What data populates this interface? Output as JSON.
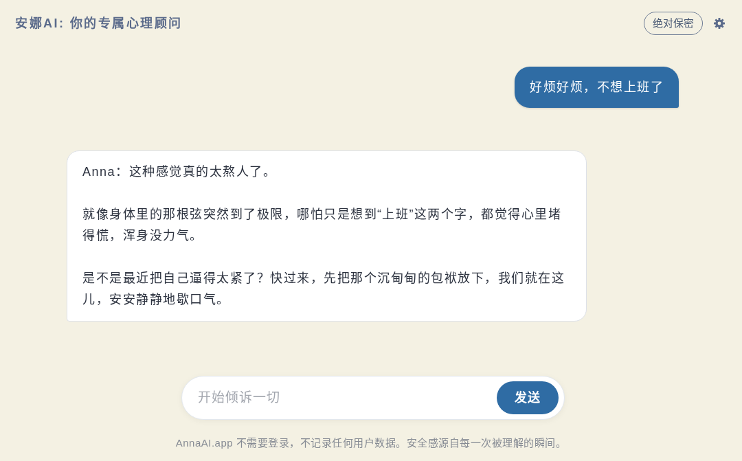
{
  "header": {
    "title": "安娜AI: 你的专属心理顾问",
    "badge": "绝对保密"
  },
  "messages": [
    {
      "kind": "user",
      "paragraphs": [
        "好烦好烦，不想上班了"
      ]
    },
    {
      "kind": "assistant",
      "paragraphs": [
        "Anna：这种感觉真的太熬人了。",
        "就像身体里的那根弦突然到了极限，哪怕只是想到“上班”这两个字，都觉得心里堵得慌，浑身没力气。",
        "是不是最近把自己逼得太紧了？快过来，先把那个沉甸甸的包袱放下，我们就在这儿，安安静静地歇口气。"
      ]
    }
  ],
  "composer": {
    "placeholder": "开始倾诉一切",
    "send_button": "发送"
  },
  "footer": "AnnaAI.app 不需要登录，不记录任何用户数据。安全感源自每一次被理解的瞬间。"
}
